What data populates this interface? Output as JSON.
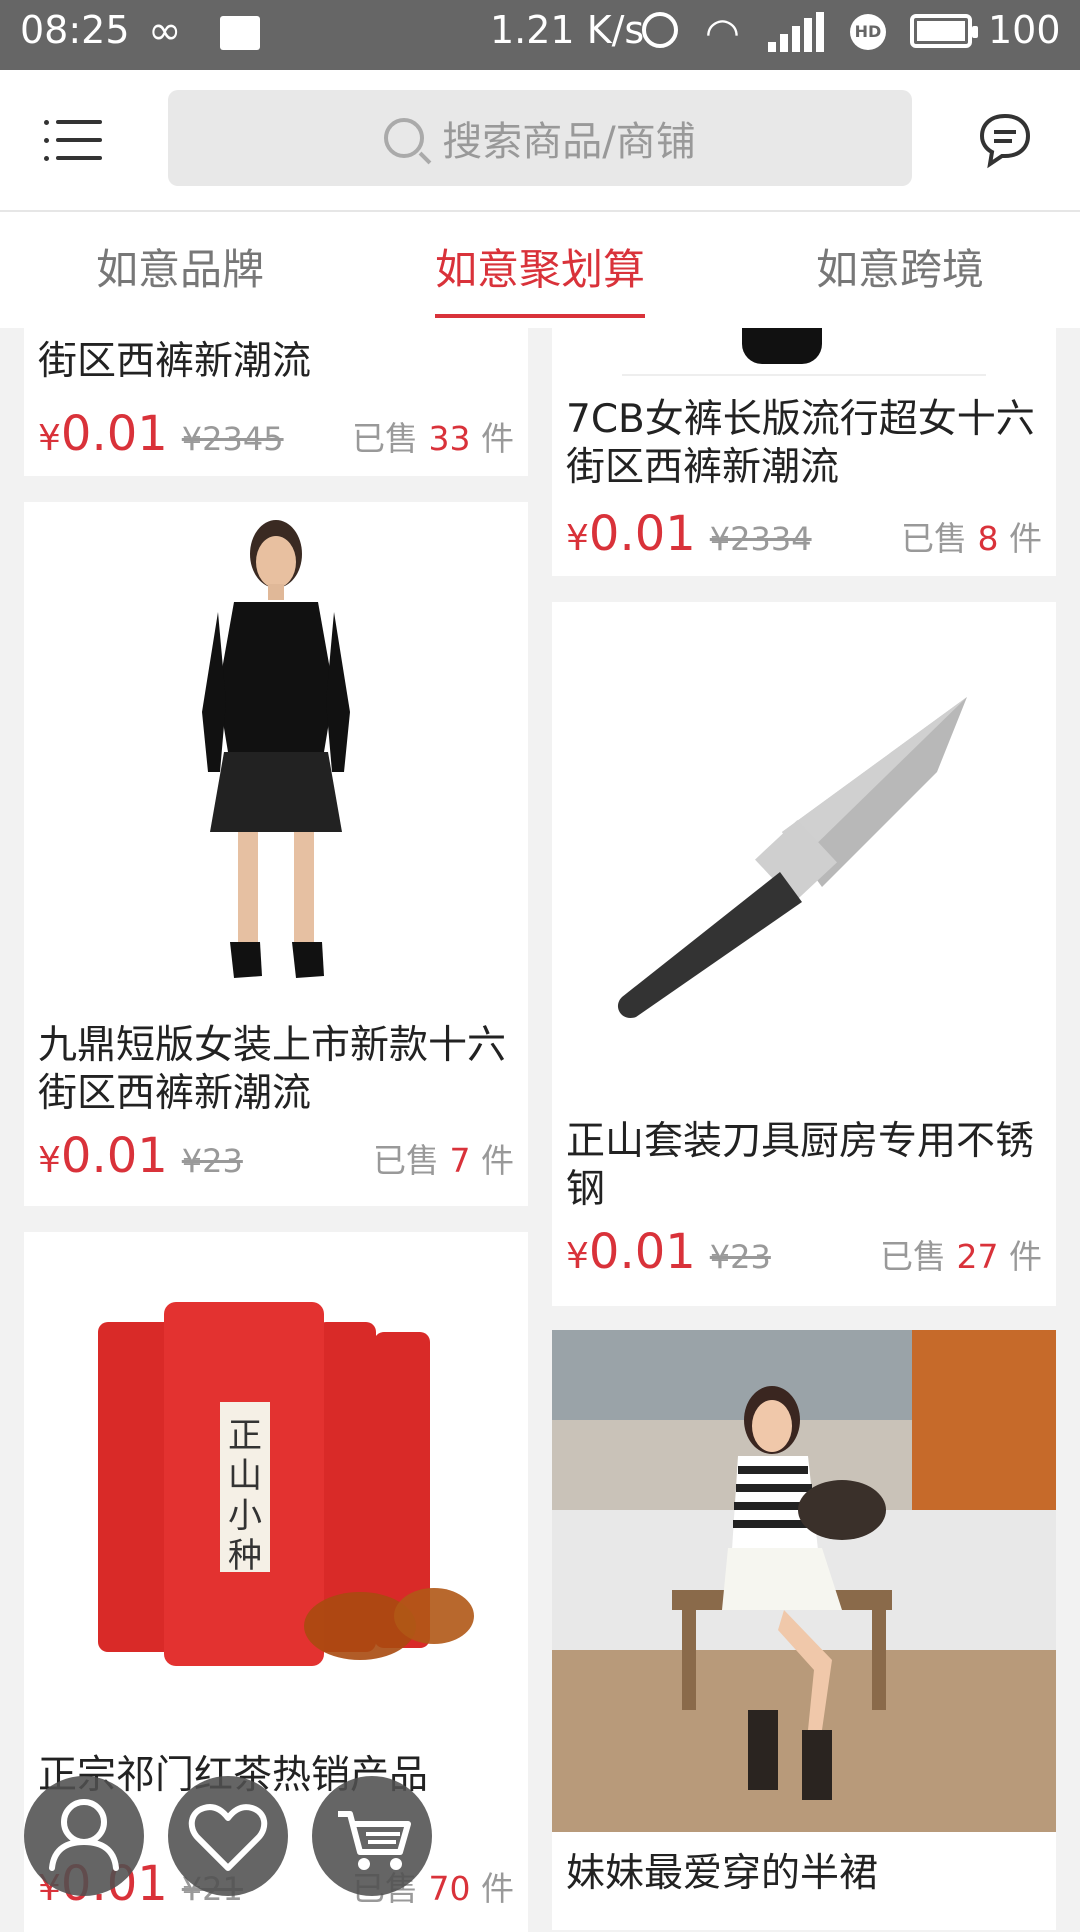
{
  "status_bar": {
    "time": "08:25",
    "speed": "1.21 K/s",
    "battery": "100",
    "hd": "HD"
  },
  "search": {
    "placeholder": "搜索商品/商铺"
  },
  "tabs": [
    {
      "label": "如意品牌",
      "active": false
    },
    {
      "label": "如意聚划算",
      "active": true
    },
    {
      "label": "如意跨境",
      "active": false
    }
  ],
  "products": [
    {
      "title": "十六街女装无论四价十六街区西裤新潮流",
      "title_visible": "街区西裤新潮流",
      "price": "0.01",
      "original": "¥2345",
      "sold_prefix": "已售",
      "sold": "33",
      "sold_suffix": "件"
    },
    {
      "title": "7CB女裤长版流行超女十六街区西裤新潮流",
      "price": "0.01",
      "original": "¥2334",
      "sold_prefix": "已售",
      "sold": "8",
      "sold_suffix": "件"
    },
    {
      "title": "九鼎短版女装上市新款十六街区西裤新潮流",
      "price": "0.01",
      "original": "¥23",
      "sold_prefix": "已售",
      "sold": "7",
      "sold_suffix": "件"
    },
    {
      "title": "正山套装刀具厨房专用不锈钢",
      "price": "0.01",
      "original": "¥23",
      "sold_prefix": "已售",
      "sold": "27",
      "sold_suffix": "件"
    },
    {
      "title": "正宗祁门红茶热销产品",
      "price": "0.01",
      "original": "¥21",
      "sold_prefix": "已售",
      "sold": "70",
      "sold_suffix": "件"
    },
    {
      "title": "妹妹最爱穿的半裙"
    }
  ],
  "tea_label": "正山小种",
  "currency": "¥",
  "colors": {
    "accent": "#d9323a",
    "statusbar": "#666666"
  },
  "fab_icons": [
    "user-icon",
    "heart-icon",
    "cart-icon"
  ]
}
